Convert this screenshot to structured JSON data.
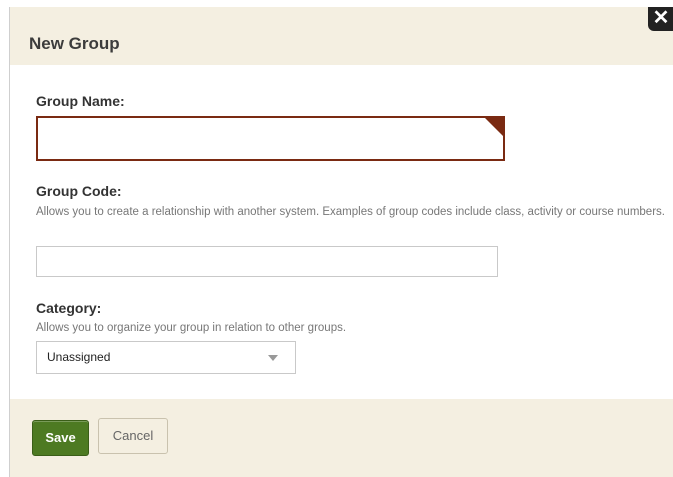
{
  "dialog": {
    "title": "New Group",
    "close_symbol": "✕",
    "close_icon": "close-icon"
  },
  "form": {
    "group_name": {
      "label": "Group Name:",
      "value": ""
    },
    "group_code": {
      "label": "Group Code:",
      "help": "Allows you to create a relationship with another system. Examples of group codes include class, activity or course numbers.",
      "value": ""
    },
    "category": {
      "label": "Category:",
      "help": "Allows you to organize your group in relation to other groups.",
      "selected": "Unassigned",
      "arrow_icon": "dropdown-arrow-icon"
    }
  },
  "footer": {
    "save_label": "Save",
    "cancel_label": "Cancel"
  },
  "colors": {
    "header_bg": "#f4efe1",
    "required_border": "#7a2a12",
    "save_bg": "#4d7a22"
  }
}
